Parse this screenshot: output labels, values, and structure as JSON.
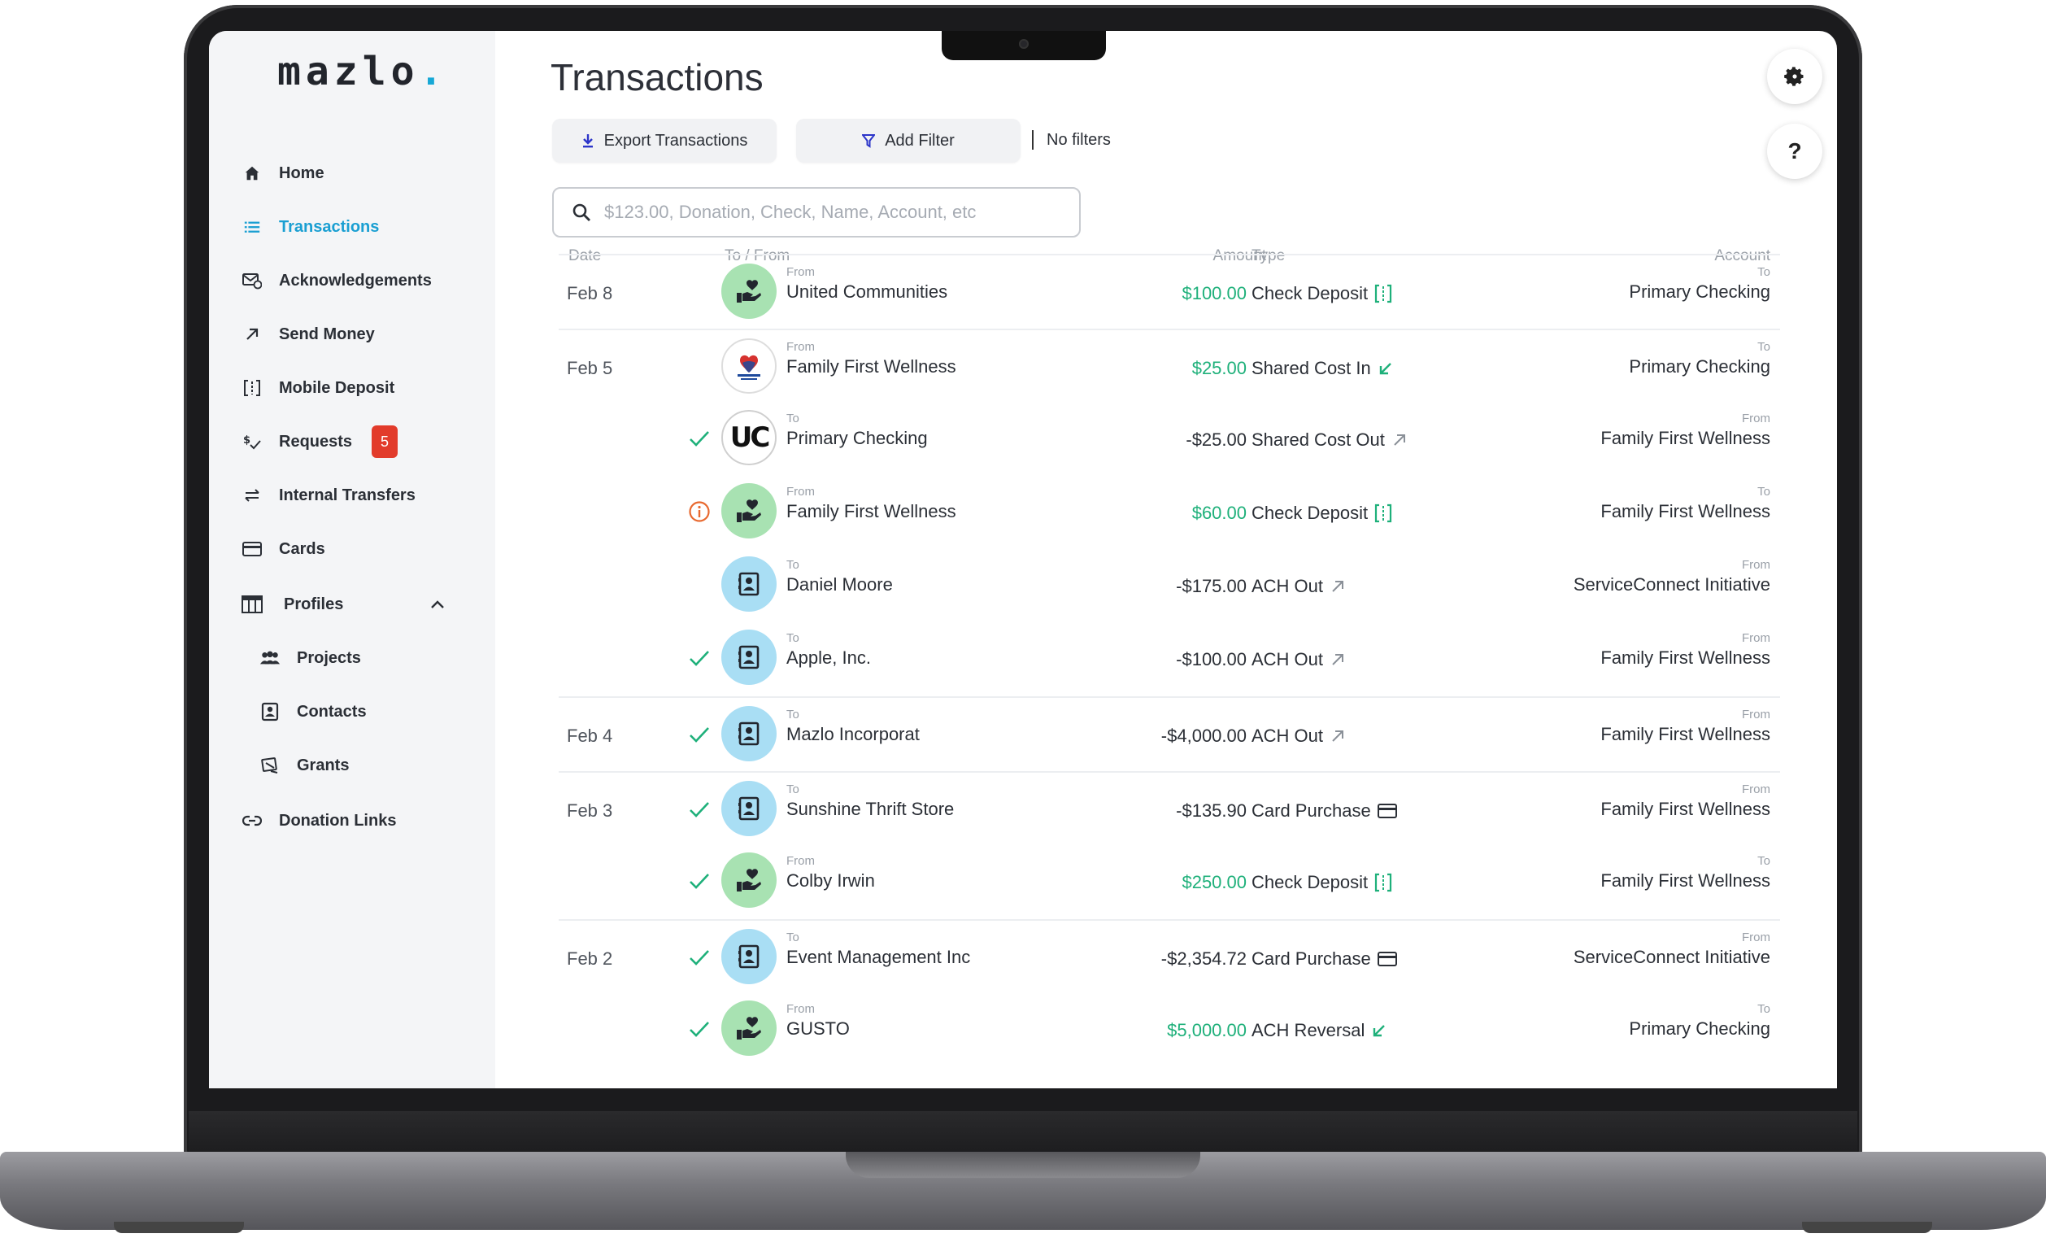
{
  "app": {
    "logo": "mazlo",
    "logo_dot": "."
  },
  "colors": {
    "accent": "#1a9fd2",
    "positive": "#1eb07a",
    "badge": "#e23b2b"
  },
  "sidebar": {
    "items": [
      {
        "label": "Home",
        "icon": "home-icon"
      },
      {
        "label": "Transactions",
        "icon": "list-icon",
        "active": true
      },
      {
        "label": "Acknowledgements",
        "icon": "mail-check-icon"
      },
      {
        "label": "Send Money",
        "icon": "arrow-up-right-icon"
      },
      {
        "label": "Mobile Deposit",
        "icon": "check-scan-icon"
      },
      {
        "label": "Requests",
        "icon": "dollar-check-icon",
        "badge": "5"
      },
      {
        "label": "Internal Transfers",
        "icon": "swap-icon"
      },
      {
        "label": "Cards",
        "icon": "card-icon"
      },
      {
        "label": "Profiles",
        "icon": "table-icon",
        "expanded": true
      },
      {
        "label": "Projects",
        "icon": "group-icon"
      },
      {
        "label": "Contacts",
        "icon": "contact-icon"
      },
      {
        "label": "Grants",
        "icon": "grant-icon"
      },
      {
        "label": "Donation Links",
        "icon": "link-icon"
      }
    ]
  },
  "main": {
    "title": "Transactions",
    "export_label": "Export Transactions",
    "filter_label": "Add Filter",
    "filter_status": "No filters",
    "search_placeholder": "$123.00, Donation, Check, Name, Account, etc",
    "help_label": "?",
    "columns": {
      "date": "Date",
      "party": "To / From",
      "amount": "Amount",
      "type": "Type",
      "account": "Account"
    }
  },
  "transactions": [
    {
      "date": "Feb 8",
      "status": "",
      "avatar": "donation",
      "dir": "From",
      "party": "United Communities",
      "amount": "$100.00",
      "positive": true,
      "type": "Check Deposit",
      "type_icon": "check-deposit-icon",
      "acct_dir": "To",
      "account": "Primary Checking"
    },
    {
      "date": "Feb 5",
      "status": "",
      "avatar": "logo",
      "dir": "From",
      "party": "Family First Wellness",
      "amount": "$25.00",
      "positive": true,
      "type": "Shared Cost In",
      "type_icon": "arrow-in-icon",
      "acct_dir": "To",
      "account": "Primary Checking"
    },
    {
      "date": "",
      "status": "check",
      "avatar": "uc",
      "avatar_text": "UC",
      "dir": "To",
      "party": "Primary Checking",
      "amount": "-$25.00",
      "positive": false,
      "type": "Shared Cost Out",
      "type_icon": "arrow-out-icon",
      "acct_dir": "From",
      "account": "Family First Wellness"
    },
    {
      "date": "",
      "status": "info",
      "avatar": "donation",
      "dir": "From",
      "party": "Family First Wellness",
      "amount": "$60.00",
      "positive": true,
      "type": "Check Deposit",
      "type_icon": "check-deposit-icon",
      "acct_dir": "To",
      "account": "Family First Wellness"
    },
    {
      "date": "",
      "status": "",
      "avatar": "contact",
      "dir": "To",
      "party": "Daniel Moore",
      "amount": "-$175.00",
      "positive": false,
      "type": "ACH Out",
      "type_icon": "arrow-out-icon",
      "acct_dir": "From",
      "account": "ServiceConnect Initiative"
    },
    {
      "date": "",
      "status": "check",
      "avatar": "contact",
      "dir": "To",
      "party": "Apple, Inc.",
      "amount": "-$100.00",
      "positive": false,
      "type": "ACH Out",
      "type_icon": "arrow-out-icon",
      "acct_dir": "From",
      "account": "Family First Wellness"
    },
    {
      "date": "Feb 4",
      "status": "check",
      "avatar": "contact",
      "dir": "To",
      "party": "Mazlo Incorporat",
      "amount": "-$4,000.00",
      "positive": false,
      "type": "ACH Out",
      "type_icon": "arrow-out-icon",
      "acct_dir": "From",
      "account": "Family First Wellness"
    },
    {
      "date": "Feb 3",
      "status": "check",
      "avatar": "contact",
      "dir": "To",
      "party": "Sunshine Thrift Store",
      "amount": "-$135.90",
      "positive": false,
      "type": "Card Purchase",
      "type_icon": "card-icon",
      "acct_dir": "From",
      "account": "Family First Wellness"
    },
    {
      "date": "",
      "status": "check",
      "avatar": "donation",
      "dir": "From",
      "party": "Colby Irwin",
      "amount": "$250.00",
      "positive": true,
      "type": "Check Deposit",
      "type_icon": "check-deposit-icon",
      "acct_dir": "To",
      "account": "Family First Wellness"
    },
    {
      "date": "Feb 2",
      "status": "check",
      "avatar": "contact",
      "dir": "To",
      "party": "Event Management Inc",
      "amount": "-$2,354.72",
      "positive": false,
      "type": "Card Purchase",
      "type_icon": "card-icon",
      "acct_dir": "From",
      "account": "ServiceConnect Initiative"
    },
    {
      "date": "",
      "status": "check",
      "avatar": "donation",
      "dir": "From",
      "party": "GUSTO",
      "amount": "$5,000.00",
      "positive": true,
      "type": "ACH Reversal",
      "type_icon": "arrow-in-icon",
      "acct_dir": "To",
      "account": "Primary Checking"
    }
  ]
}
